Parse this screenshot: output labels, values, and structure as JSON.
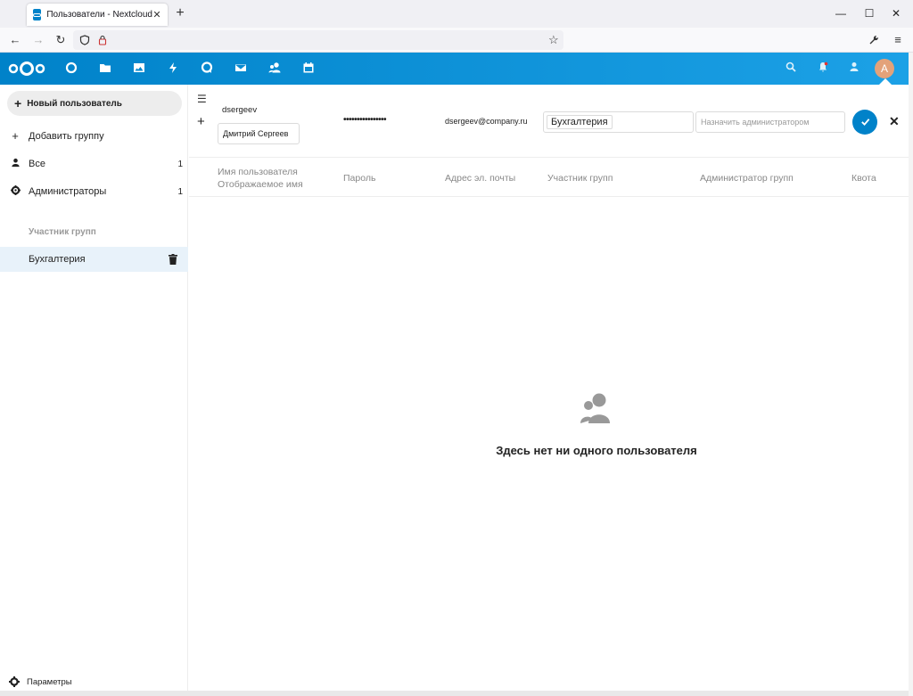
{
  "browser": {
    "tab_title": "Пользователи - Nextcloud",
    "new_tab_icon": "plus-icon"
  },
  "header": {
    "apps": [
      "dashboard-icon",
      "files-icon",
      "photos-icon",
      "activity-icon",
      "talk-icon",
      "mail-icon",
      "contacts-icon",
      "calendar-icon"
    ],
    "avatar_letter": "A",
    "brand_color": "#0082c9"
  },
  "sidebar": {
    "new_user_label": "Новый пользователь",
    "add_group_label": "Добавить группу",
    "all_label": "Все",
    "all_count": "1",
    "admins_label": "Администраторы",
    "admins_count": "1",
    "groups_caption": "Участник групп",
    "group_item_label": "Бухгалтерия",
    "settings_label": "Параметры"
  },
  "new_user_form": {
    "username": "dsergeev",
    "display_name": "Дмитрий Сергеев",
    "password_mask": "••••••••••••••••",
    "email": "dsergeev@company.ru",
    "group_tag": "Бухгалтерия",
    "admin_placeholder": "Назначить администратором"
  },
  "columns": {
    "username": "Имя пользователя",
    "display_name": "Отображаемое имя",
    "password": "Пароль",
    "email": "Адрес эл. почты",
    "groups": "Участник групп",
    "group_admin": "Администратор групп",
    "quota": "Квота"
  },
  "empty_state": {
    "message": "Здесь нет ни одного пользователя"
  }
}
